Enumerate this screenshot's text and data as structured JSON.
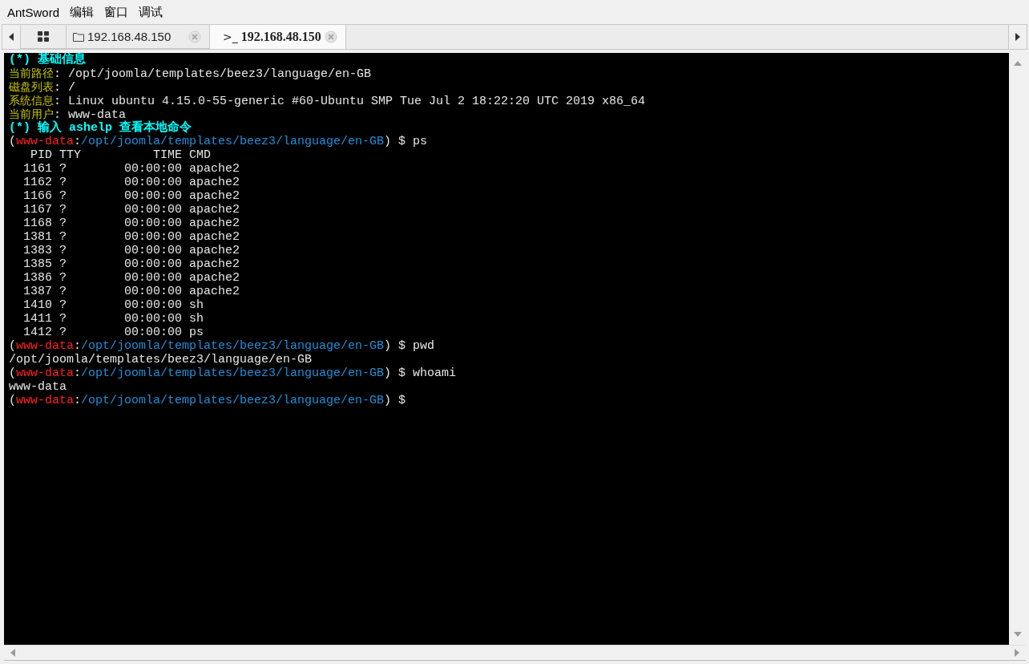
{
  "menu": [
    "AntSword",
    "编辑",
    "窗口",
    "调试"
  ],
  "tabs": [
    {
      "kind": "home",
      "selected": false
    },
    {
      "kind": "files",
      "label": "192.168.48.150",
      "selected": false
    },
    {
      "kind": "terminal",
      "icon_text": ">_",
      "label": "192.168.48.150",
      "selected": true
    }
  ],
  "terminal": {
    "lines": [
      {
        "kind": "heading",
        "text": "(*) 基础信息"
      },
      {
        "kind": "info",
        "label": "当前路径",
        "value": ": /opt/joomla/templates/beez3/language/en-GB"
      },
      {
        "kind": "info",
        "label": "磁盘列表",
        "value": ": /"
      },
      {
        "kind": "info",
        "label": "系统信息",
        "value": ": Linux ubuntu 4.15.0-55-generic #60-Ubuntu SMP Tue Jul 2 18:22:20 UTC 2019 x86_64"
      },
      {
        "kind": "info",
        "label": "当前用户",
        "value": ": www-data"
      },
      {
        "kind": "heading",
        "text": "(*) 输入 ashelp 查看本地命令"
      },
      {
        "kind": "prompt",
        "parts": [
          {
            "kind": "plain",
            "text": "("
          },
          {
            "kind": "user",
            "text": "www-data"
          },
          {
            "kind": "plain",
            "text": ":"
          },
          {
            "kind": "path",
            "text": "/opt/joomla/templates/beez3/language/en-GB"
          },
          {
            "kind": "plain",
            "text": ") $ ps"
          }
        ]
      },
      {
        "kind": "output",
        "text": "   PID TTY          TIME CMD"
      },
      {
        "kind": "output",
        "text": "  1161 ?        00:00:00 apache2"
      },
      {
        "kind": "output",
        "text": "  1162 ?        00:00:00 apache2"
      },
      {
        "kind": "output",
        "text": "  1166 ?        00:00:00 apache2"
      },
      {
        "kind": "output",
        "text": "  1167 ?        00:00:00 apache2"
      },
      {
        "kind": "output",
        "text": "  1168 ?        00:00:00 apache2"
      },
      {
        "kind": "output",
        "text": "  1381 ?        00:00:00 apache2"
      },
      {
        "kind": "output",
        "text": "  1383 ?        00:00:00 apache2"
      },
      {
        "kind": "output",
        "text": "  1385 ?        00:00:00 apache2"
      },
      {
        "kind": "output",
        "text": "  1386 ?        00:00:00 apache2"
      },
      {
        "kind": "output",
        "text": "  1387 ?        00:00:00 apache2"
      },
      {
        "kind": "output",
        "text": "  1410 ?        00:00:00 sh"
      },
      {
        "kind": "output",
        "text": "  1411 ?        00:00:00 sh"
      },
      {
        "kind": "output",
        "text": "  1412 ?        00:00:00 ps"
      },
      {
        "kind": "prompt",
        "parts": [
          {
            "kind": "plain",
            "text": "("
          },
          {
            "kind": "user",
            "text": "www-data"
          },
          {
            "kind": "plain",
            "text": ":"
          },
          {
            "kind": "path",
            "text": "/opt/joomla/templates/beez3/language/en-GB"
          },
          {
            "kind": "plain",
            "text": ") $ pwd"
          }
        ]
      },
      {
        "kind": "output",
        "text": "/opt/joomla/templates/beez3/language/en-GB"
      },
      {
        "kind": "prompt",
        "parts": [
          {
            "kind": "plain",
            "text": "("
          },
          {
            "kind": "user",
            "text": "www-data"
          },
          {
            "kind": "plain",
            "text": ":"
          },
          {
            "kind": "path",
            "text": "/opt/joomla/templates/beez3/language/en-GB"
          },
          {
            "kind": "plain",
            "text": ") $ whoami"
          }
        ]
      },
      {
        "kind": "output",
        "text": "www-data"
      },
      {
        "kind": "prompt",
        "parts": [
          {
            "kind": "plain",
            "text": "("
          },
          {
            "kind": "user",
            "text": "www-data"
          },
          {
            "kind": "plain",
            "text": ":"
          },
          {
            "kind": "path",
            "text": "/opt/joomla/templates/beez3/language/en-GB"
          },
          {
            "kind": "plain",
            "text": ") $"
          }
        ]
      }
    ]
  }
}
